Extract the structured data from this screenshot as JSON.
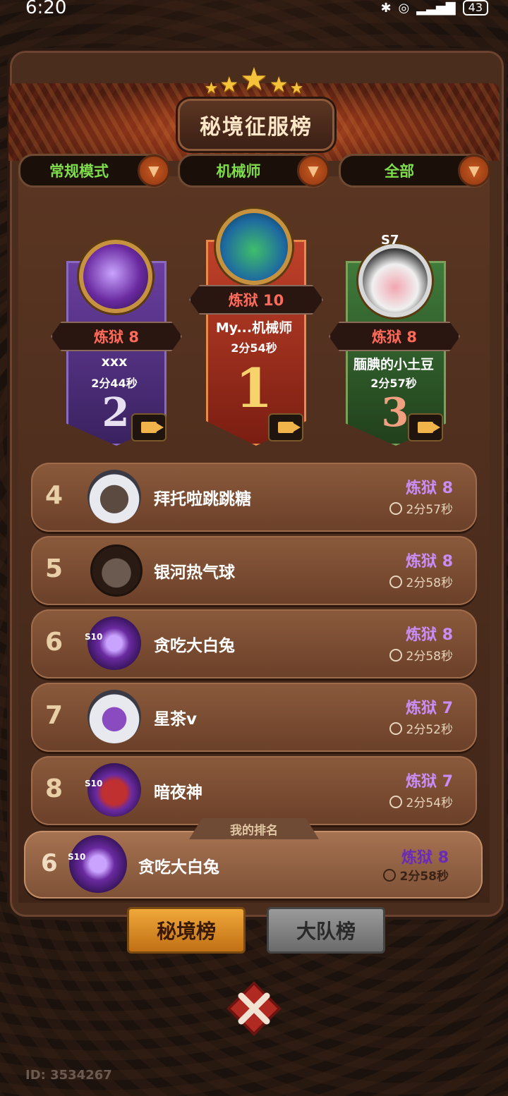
{
  "statusbar": {
    "time": "6:20",
    "battery": "43"
  },
  "header": {
    "title": "秘境征服榜"
  },
  "filters": [
    {
      "label": "常规模式"
    },
    {
      "label": "机械师"
    },
    {
      "label": "全部"
    }
  ],
  "podium": {
    "first": {
      "rank": "1",
      "level": "炼狱 10",
      "name": "My...机械师",
      "time": "2分54秒"
    },
    "second": {
      "rank": "2",
      "level": "炼狱 8",
      "name": "xxx",
      "time": "2分44秒"
    },
    "third": {
      "rank": "3",
      "level": "炼狱 8",
      "name": "腼腆的小土豆",
      "time": "2分57秒",
      "season_badge": "S7"
    }
  },
  "rows": [
    {
      "rank": "4",
      "name": "拜托啦跳跳糖",
      "level": "炼狱 8",
      "time": "2分57秒"
    },
    {
      "rank": "5",
      "name": "银河热气球",
      "level": "炼狱 8",
      "time": "2分58秒"
    },
    {
      "rank": "6",
      "name": "贪吃大白兔",
      "level": "炼狱 8",
      "time": "2分58秒",
      "badge": "S10"
    },
    {
      "rank": "7",
      "name": "星茶v",
      "level": "炼狱 7",
      "time": "2分52秒"
    },
    {
      "rank": "8",
      "name": "暗夜神",
      "level": "炼狱 7",
      "time": "2分54秒",
      "badge": "S10"
    }
  ],
  "my_rank": {
    "label": "我的排名",
    "rank": "6",
    "name": "贪吃大白兔",
    "level": "炼狱 8",
    "time": "2分58秒",
    "badge": "S10"
  },
  "tabs": [
    {
      "label": "秘境榜"
    },
    {
      "label": "大队榜"
    }
  ],
  "footer": {
    "id": "ID: 3534267"
  },
  "colors": {
    "level_purple": "#c98df5",
    "level_red": "#ff6b5a",
    "filter_green": "#7fdc4a"
  }
}
